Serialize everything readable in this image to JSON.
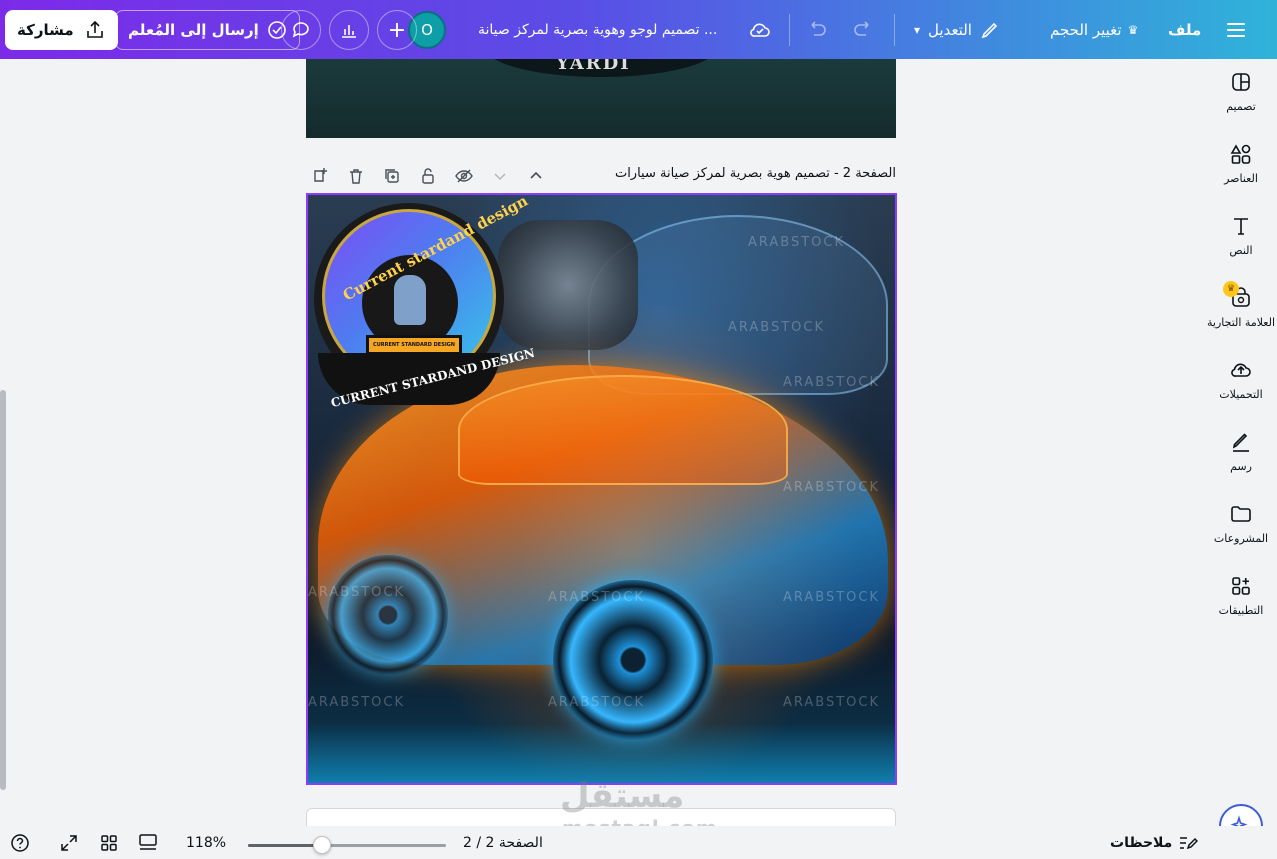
{
  "topbar": {
    "menu_icon": "hamburger-icon",
    "file_label": "ملف",
    "resize_label": "تغيير الحجم",
    "edit_label": "التعديل",
    "design_title": "تصميم لوجو وهوية بصرية لمركز صيانة ...",
    "avatar_initial": "O",
    "send_teacher_label": "إرسال إلى المُعلم",
    "share_label": "مشاركة"
  },
  "sidebar": {
    "items": [
      {
        "label": "تصميم",
        "icon": "design-icon"
      },
      {
        "label": "العناصر",
        "icon": "elements-icon"
      },
      {
        "label": "النص",
        "icon": "text-icon"
      },
      {
        "label": "العلامة التجارية",
        "icon": "brand-icon"
      },
      {
        "label": "التحميلات",
        "icon": "upload-icon"
      },
      {
        "label": "رسم",
        "icon": "draw-icon"
      },
      {
        "label": "المشروعات",
        "icon": "folder-icon"
      },
      {
        "label": "التطبيقات",
        "icon": "apps-icon"
      }
    ]
  },
  "canvas": {
    "prev_page_text": "YARDI",
    "page_title": "الصفحة 2 - تصميم هوية بصرية لمركز صيانة سيارات",
    "logo_arc_text": "Current stardand design",
    "logo_plate_text": "CURRENT STANDARD DESIGN",
    "logo_band_text": "CURRENT STARDAND DESIGN",
    "image_watermark": "ARABSTOCK"
  },
  "watermark": {
    "arabic": "مستقل",
    "latin": "mostaql.com"
  },
  "bottombar": {
    "notes_label": "ملاحظات",
    "page_indicator": "الصفحة 2 / 2",
    "zoom": "118%"
  },
  "colors": {
    "brand_purple": "#7d2ae8",
    "brand_teal": "#2fb3d9",
    "selection_border": "#8b3dff"
  }
}
